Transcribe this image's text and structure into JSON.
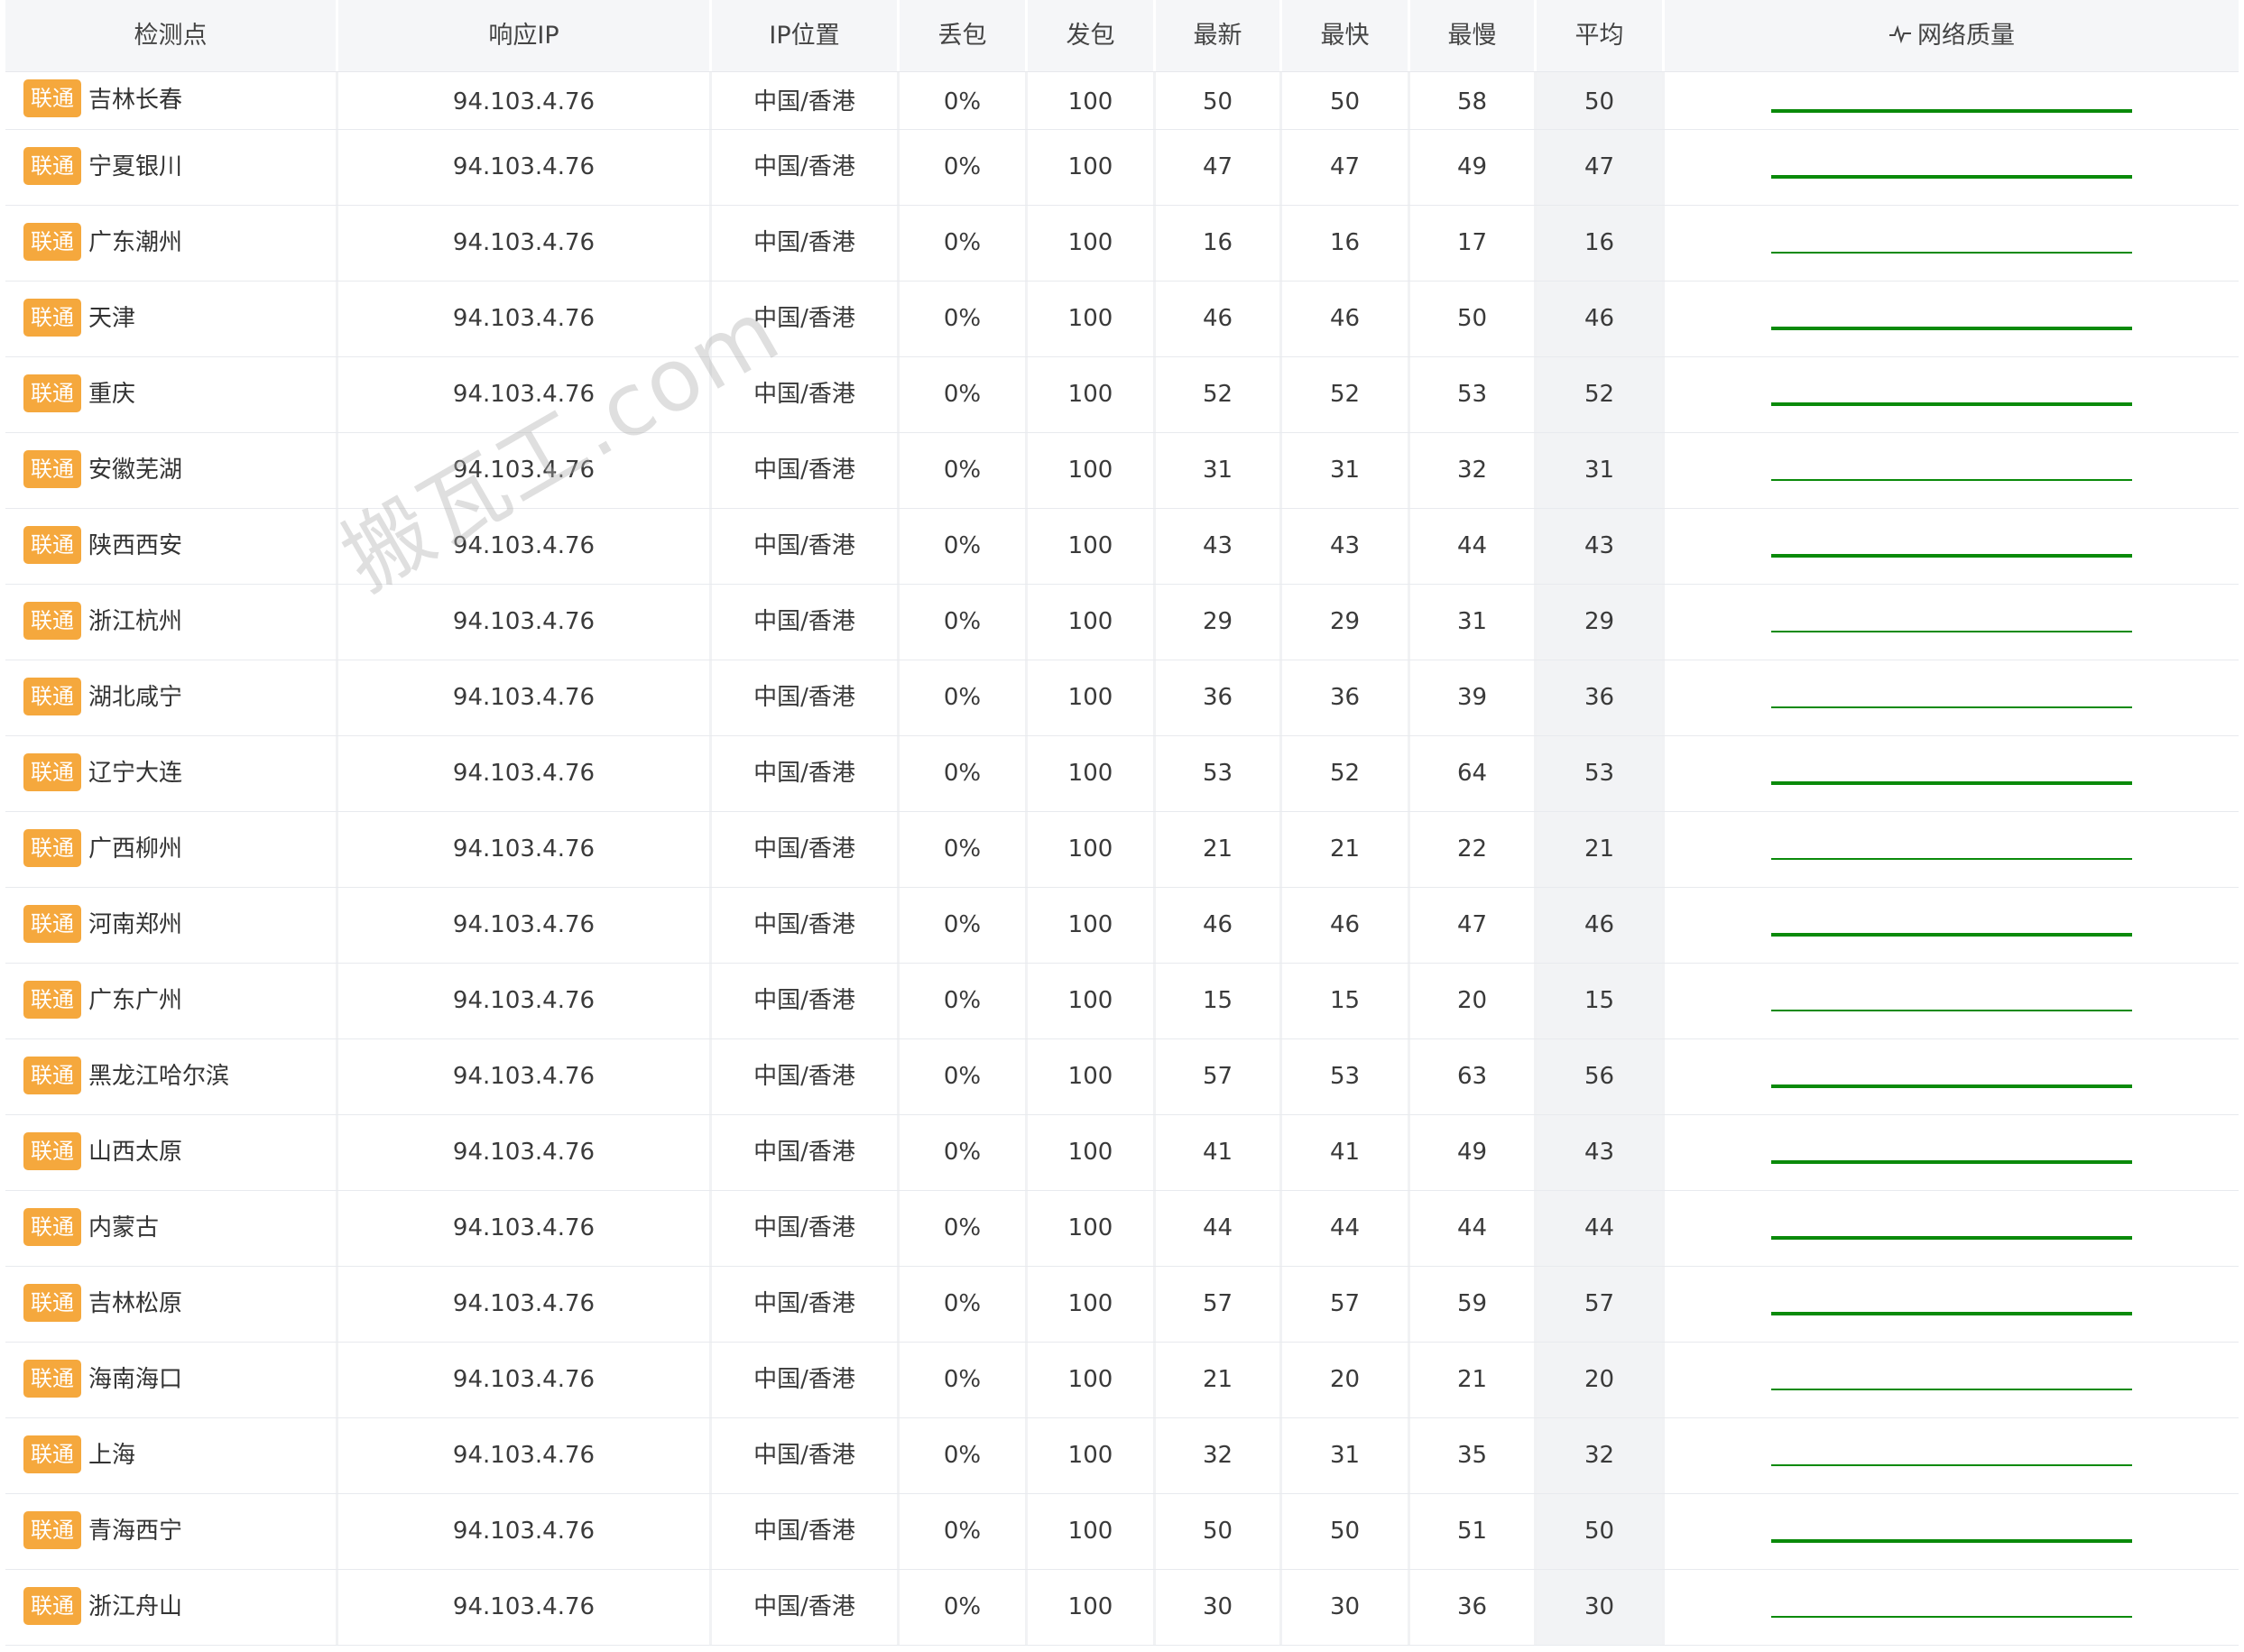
{
  "columns": {
    "node": "检测点",
    "ip": "响应IP",
    "location": "IP位置",
    "loss": "丢包",
    "sent": "发包",
    "last": "最新",
    "best": "最快",
    "worst": "最慢",
    "avg": "平均",
    "quality": "网络质量",
    "quality_icon": "pulse-icon"
  },
  "colors": {
    "badge": "#f5a83d",
    "sparkline": "#0a8a0a",
    "header_bg": "#f5f6f8",
    "avg_bg": "#f2f3f5"
  },
  "watermark": "搬瓦工.com",
  "rows": [
    {
      "isp": "联通",
      "node": "吉林长春",
      "ip": "94.103.4.76",
      "location": "中国/香港",
      "loss": "0%",
      "sent": "100",
      "last": "50",
      "best": "50",
      "worst": "58",
      "avg": "50",
      "quality_level": 0.88
    },
    {
      "isp": "联通",
      "node": "宁夏银川",
      "ip": "94.103.4.76",
      "location": "中国/香港",
      "loss": "0%",
      "sent": "100",
      "last": "47",
      "best": "47",
      "worst": "49",
      "avg": "47",
      "quality_level": 0.89
    },
    {
      "isp": "联通",
      "node": "广东潮州",
      "ip": "94.103.4.76",
      "location": "中国/香港",
      "loss": "0%",
      "sent": "100",
      "last": "16",
      "best": "16",
      "worst": "17",
      "avg": "16",
      "quality_level": 0.97
    },
    {
      "isp": "联通",
      "node": "天津",
      "ip": "94.103.4.76",
      "location": "中国/香港",
      "loss": "0%",
      "sent": "100",
      "last": "46",
      "best": "46",
      "worst": "50",
      "avg": "46",
      "quality_level": 0.89
    },
    {
      "isp": "联通",
      "node": "重庆",
      "ip": "94.103.4.76",
      "location": "中国/香港",
      "loss": "0%",
      "sent": "100",
      "last": "52",
      "best": "52",
      "worst": "53",
      "avg": "52",
      "quality_level": 0.88
    },
    {
      "isp": "联通",
      "node": "安徽芜湖",
      "ip": "94.103.4.76",
      "location": "中国/香港",
      "loss": "0%",
      "sent": "100",
      "last": "31",
      "best": "31",
      "worst": "32",
      "avg": "31",
      "quality_level": 0.93
    },
    {
      "isp": "联通",
      "node": "陕西西安",
      "ip": "94.103.4.76",
      "location": "中国/香港",
      "loss": "0%",
      "sent": "100",
      "last": "43",
      "best": "43",
      "worst": "44",
      "avg": "43",
      "quality_level": 0.9
    },
    {
      "isp": "联通",
      "node": "浙江杭州",
      "ip": "94.103.4.76",
      "location": "中国/香港",
      "loss": "0%",
      "sent": "100",
      "last": "29",
      "best": "29",
      "worst": "31",
      "avg": "29",
      "quality_level": 0.93
    },
    {
      "isp": "联通",
      "node": "湖北咸宁",
      "ip": "94.103.4.76",
      "location": "中国/香港",
      "loss": "0%",
      "sent": "100",
      "last": "36",
      "best": "36",
      "worst": "39",
      "avg": "36",
      "quality_level": 0.92
    },
    {
      "isp": "联通",
      "node": "辽宁大连",
      "ip": "94.103.4.76",
      "location": "中国/香港",
      "loss": "0%",
      "sent": "100",
      "last": "53",
      "best": "52",
      "worst": "64",
      "avg": "53",
      "quality_level": 0.87
    },
    {
      "isp": "联通",
      "node": "广西柳州",
      "ip": "94.103.4.76",
      "location": "中国/香港",
      "loss": "0%",
      "sent": "100",
      "last": "21",
      "best": "21",
      "worst": "22",
      "avg": "21",
      "quality_level": 0.95
    },
    {
      "isp": "联通",
      "node": "河南郑州",
      "ip": "94.103.4.76",
      "location": "中国/香港",
      "loss": "0%",
      "sent": "100",
      "last": "46",
      "best": "46",
      "worst": "47",
      "avg": "46",
      "quality_level": 0.89
    },
    {
      "isp": "联通",
      "node": "广东广州",
      "ip": "94.103.4.76",
      "location": "中国/香港",
      "loss": "0%",
      "sent": "100",
      "last": "15",
      "best": "15",
      "worst": "20",
      "avg": "15",
      "quality_level": 0.97
    },
    {
      "isp": "联通",
      "node": "黑龙江哈尔滨",
      "ip": "94.103.4.76",
      "location": "中国/香港",
      "loss": "0%",
      "sent": "100",
      "last": "57",
      "best": "53",
      "worst": "63",
      "avg": "56",
      "quality_level": 0.86
    },
    {
      "isp": "联通",
      "node": "山西太原",
      "ip": "94.103.4.76",
      "location": "中国/香港",
      "loss": "0%",
      "sent": "100",
      "last": "41",
      "best": "41",
      "worst": "49",
      "avg": "43",
      "quality_level": 0.9
    },
    {
      "isp": "联通",
      "node": "内蒙古",
      "ip": "94.103.4.76",
      "location": "中国/香港",
      "loss": "0%",
      "sent": "100",
      "last": "44",
      "best": "44",
      "worst": "44",
      "avg": "44",
      "quality_level": 0.89
    },
    {
      "isp": "联通",
      "node": "吉林松原",
      "ip": "94.103.4.76",
      "location": "中国/香港",
      "loss": "0%",
      "sent": "100",
      "last": "57",
      "best": "57",
      "worst": "59",
      "avg": "57",
      "quality_level": 0.86
    },
    {
      "isp": "联通",
      "node": "海南海口",
      "ip": "94.103.4.76",
      "location": "中国/香港",
      "loss": "0%",
      "sent": "100",
      "last": "21",
      "best": "20",
      "worst": "21",
      "avg": "20",
      "quality_level": 0.95
    },
    {
      "isp": "联通",
      "node": "上海",
      "ip": "94.103.4.76",
      "location": "中国/香港",
      "loss": "0%",
      "sent": "100",
      "last": "32",
      "best": "31",
      "worst": "35",
      "avg": "32",
      "quality_level": 0.92
    },
    {
      "isp": "联通",
      "node": "青海西宁",
      "ip": "94.103.4.76",
      "location": "中国/香港",
      "loss": "0%",
      "sent": "100",
      "last": "50",
      "best": "50",
      "worst": "51",
      "avg": "50",
      "quality_level": 0.88
    },
    {
      "isp": "联通",
      "node": "浙江舟山",
      "ip": "94.103.4.76",
      "location": "中国/香港",
      "loss": "0%",
      "sent": "100",
      "last": "30",
      "best": "30",
      "worst": "36",
      "avg": "30",
      "quality_level": 0.93
    }
  ]
}
